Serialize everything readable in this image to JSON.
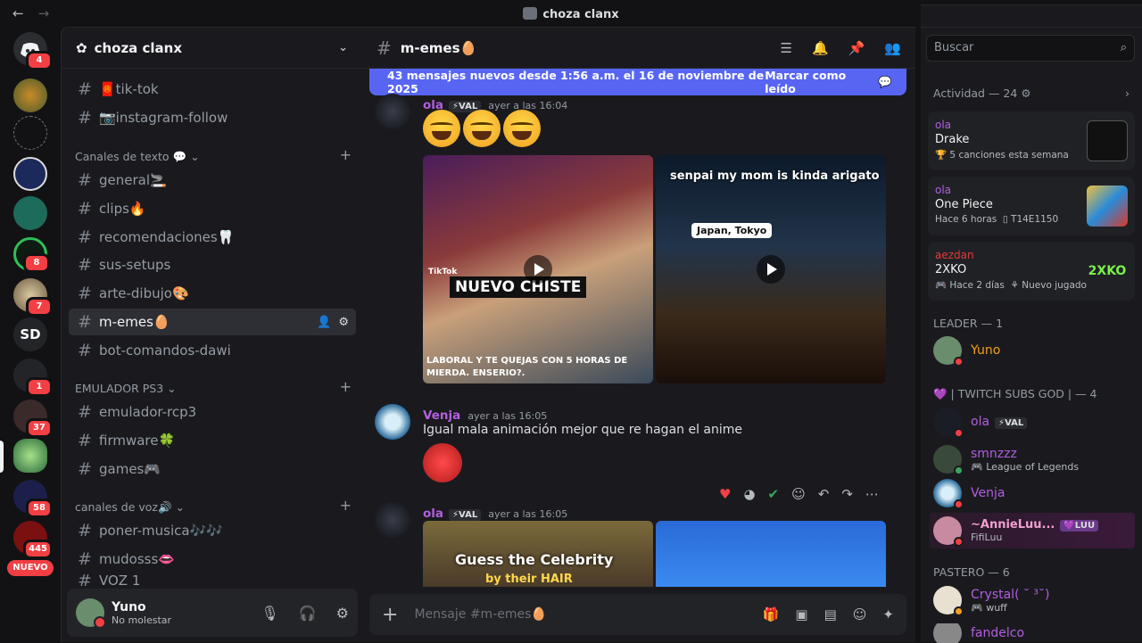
{
  "window": {
    "title": "choza clanx",
    "back": "←",
    "forward": "→",
    "minimize": "—",
    "maximize": "☐",
    "close": "✕"
  },
  "rail": {
    "home_badge": "4",
    "badges": [
      "8",
      "7",
      "1",
      "37",
      "58",
      "445"
    ],
    "sd_label": "SD",
    "nuevo_label": "NUEVO"
  },
  "sidebar": {
    "guild_name": "choza clanx",
    "top_channels": [
      "🧧tik-tok",
      "📷instagram-follow"
    ],
    "categories": [
      {
        "name": "Canales de texto 💬",
        "channels": [
          "general🚬",
          "clips🔥",
          "recomendaciones🦷",
          "sus-setups",
          "arte-dibujo🎨",
          "m-emes🥚",
          "bot-comandos-dawi"
        ]
      },
      {
        "name": "EMULADOR PS3",
        "channels": [
          "emulador-rcp3",
          "firmware🍀",
          "games🎮"
        ]
      },
      {
        "name": "canales de voz🔊",
        "channels": [
          "poner-musica🎶🎶",
          "mudosss👄",
          "VOZ 1"
        ]
      }
    ],
    "user": {
      "name": "Yuno",
      "status": "No molestar"
    }
  },
  "channel": {
    "name": "m-emes🥚",
    "new_messages_banner": "43 mensajes nuevos desde 1:56 a.m. el 16 de noviembre de 2025",
    "mark_read": "Marcar como leído",
    "messages": [
      {
        "author": "ola",
        "tag": "⚡VAL",
        "time": "ayer a las 16:04",
        "video1_overlay": "NUEVO CHISTE",
        "video1_caption": "LABORAL Y TE QUEJAS CON 5 HORAS DE MIERDA. ENSERIO?.",
        "video1_brand": "TikTok",
        "video2_overlay": "senpai my mom is kinda arigato",
        "video2_tag": "Japan, Tokyo"
      },
      {
        "author": "Venja",
        "time": "ayer a las 16:05",
        "text": "Igual mala animación mejor que re hagan el anime"
      },
      {
        "author": "ola",
        "tag": "⚡VAL",
        "time": "ayer a las 16:05",
        "video1_overlay": "Guess the Celebrity",
        "video1_sub": "by their HAIR"
      }
    ],
    "composer_placeholder": "Mensaje #m-emes🥚"
  },
  "right": {
    "search_placeholder": "Buscar",
    "activity_header": "Actividad — 24",
    "activities": [
      {
        "user": "ola",
        "title": "Drake",
        "sub": "5 canciones esta semana"
      },
      {
        "user": "ola",
        "title": "One Piece",
        "sub": "Hace 6 horas",
        "sub2": "T14E1150"
      },
      {
        "user": "aezdan",
        "title": "2XKO",
        "sub": "Hace 2 días",
        "sub2": "Nuevo jugador",
        "thumb": "2XKO"
      }
    ],
    "groups": [
      {
        "name": "LEADER — 1",
        "members": [
          {
            "name": "Yuno"
          }
        ]
      },
      {
        "name": "💜 | TWITCH SUBS GOD | — 4",
        "members": [
          {
            "name": "ola",
            "tag": "⚡VAL"
          },
          {
            "name": "smnzzz",
            "sub": "League of Legends"
          },
          {
            "name": "Venja"
          },
          {
            "name": "~AnnieLuu...",
            "tag": "💜LUU",
            "sub": "FifiLuu"
          }
        ]
      },
      {
        "name": "PASTERO — 6",
        "members": [
          {
            "name": "Crystal( ˘ ³˘)",
            "sub": "wuff"
          },
          {
            "name": "fandelco"
          }
        ]
      }
    ]
  }
}
